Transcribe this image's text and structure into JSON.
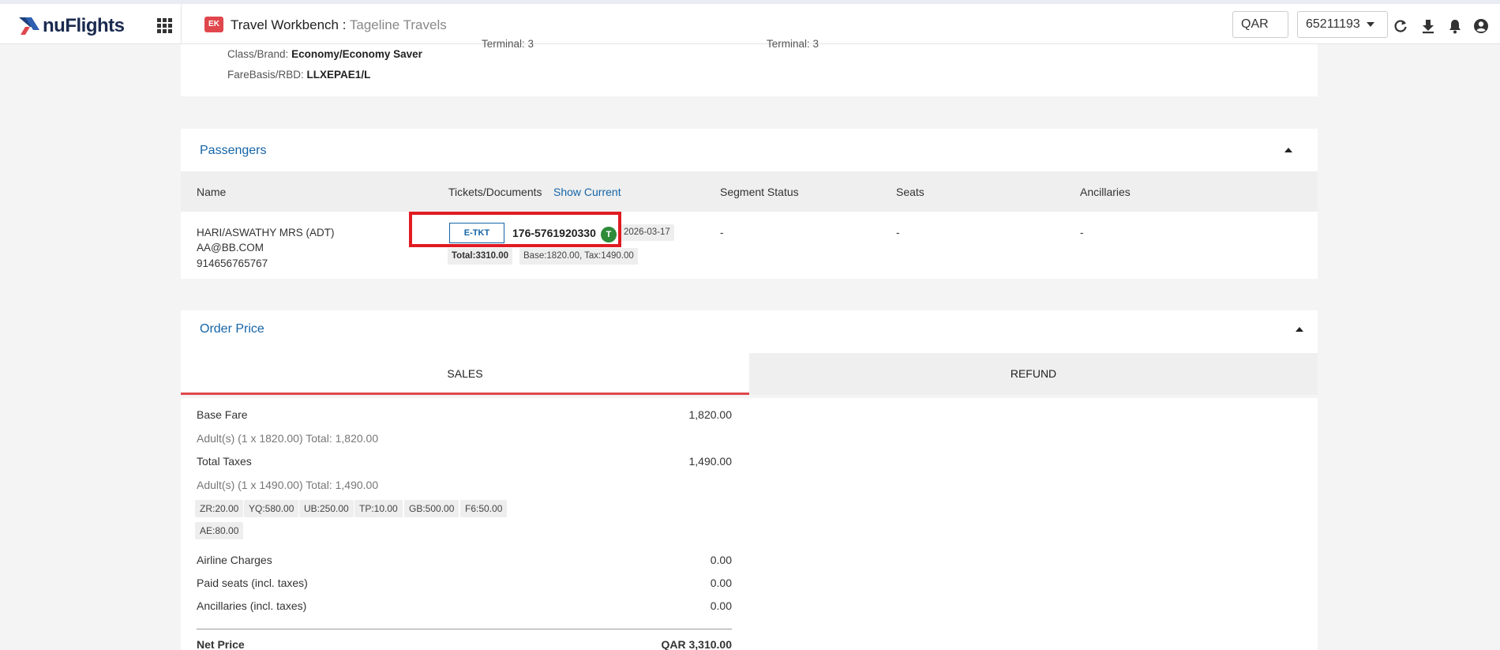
{
  "header": {
    "logo_text": "nuFlights",
    "app_badge": "EK",
    "app_title": "Travel Workbench :",
    "app_subtitle": "Tageline Travels",
    "currency": "QAR",
    "agent_id": "65211193",
    "icons": [
      "refresh-icon",
      "download-icon",
      "bell-icon",
      "user-icon"
    ]
  },
  "segment": {
    "class_label": "Class/Brand:",
    "class_value": "Economy/Economy Saver",
    "farebasis_label": "FareBasis/RBD:",
    "farebasis_value": "LLXEPAE1/L",
    "departure_terminal": "Terminal: 3",
    "arrival_terminal": "Terminal: 3"
  },
  "passengers": {
    "title": "Passengers",
    "columns": {
      "name": "Name",
      "tickets": "Tickets/Documents",
      "show_current": "Show Current",
      "segment_status": "Segment Status",
      "seats": "Seats",
      "ancillaries": "Ancillaries"
    },
    "rows": [
      {
        "name": "HARI/ASWATHY MRS (ADT)",
        "email": "AA@BB.COM",
        "phone": "914656765767",
        "doc_type": "E-TKT",
        "ticket_number": "176-5761920330",
        "ticket_badge": "T",
        "issue_date": "2026-03-17",
        "total": "Total:3310.00",
        "breakdown": "Base:1820.00, Tax:1490.00",
        "segment_status": "-",
        "seats": "-",
        "ancillaries": "-"
      }
    ]
  },
  "order_price": {
    "title": "Order Price",
    "tabs": {
      "sales": "SALES",
      "refund": "REFUND"
    },
    "base_fare_label": "Base Fare",
    "base_fare_value": "1,820.00",
    "base_fare_detail": "Adult(s) (1 x 1820.00) Total: 1,820.00",
    "total_taxes_label": "Total Taxes",
    "total_taxes_value": "1,490.00",
    "total_taxes_detail": "Adult(s) (1 x 1490.00) Total: 1,490.00",
    "taxes": [
      "ZR:20.00",
      "YQ:580.00",
      "UB:250.00",
      "TP:10.00",
      "GB:500.00",
      "F6:50.00",
      "AE:80.00"
    ],
    "airline_charges_label": "Airline Charges",
    "airline_charges_value": "0.00",
    "paid_seats_label": "Paid seats (incl. taxes)",
    "paid_seats_value": "0.00",
    "ancillaries_label": "Ancillaries (incl. taxes)",
    "ancillaries_value": "0.00",
    "net_price_label": "Net Price",
    "net_price_value": "QAR 3,310.00"
  },
  "colors": {
    "brand_blue": "#1565a8",
    "accent_red": "#e0474c",
    "highlight_red": "#e11b22",
    "badge_green": "#2e8b3a"
  }
}
